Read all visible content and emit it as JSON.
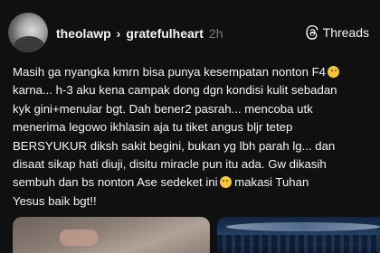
{
  "post": {
    "username": "theolawp",
    "separator": "›",
    "community": "gratefulheart",
    "timestamp": "2h",
    "brand_label": "Threads",
    "text_lines": [
      "Masih ga nyangka kmrn bisa punya kesempatan nonton F4",
      "karna... h-3 aku kena campak dong dgn kondisi kulit sebadan",
      "kyk gini+menular bgt. Dah bener2 pasrah... mencoba utk",
      "menerima legowo ikhlasin aja tu tiket angus bljr tetep",
      "BERSYUKUR diksh sakit begini, bukan yg lbh parah lg... dan",
      "disaat sikap hati diuji, disitu miracle pun itu ada. Gw dikasih",
      "sembuh dan bs nonton Ase sedeket ini",
      " makasi Tuhan",
      "Yesus baik bgt!!"
    ],
    "icons": {
      "avatar": "profile-photo",
      "brand": "threads-logo-icon",
      "emoji_1": "smiling-face-with-tear-emoji",
      "emoji_2": "pleading-face-emoji"
    }
  }
}
